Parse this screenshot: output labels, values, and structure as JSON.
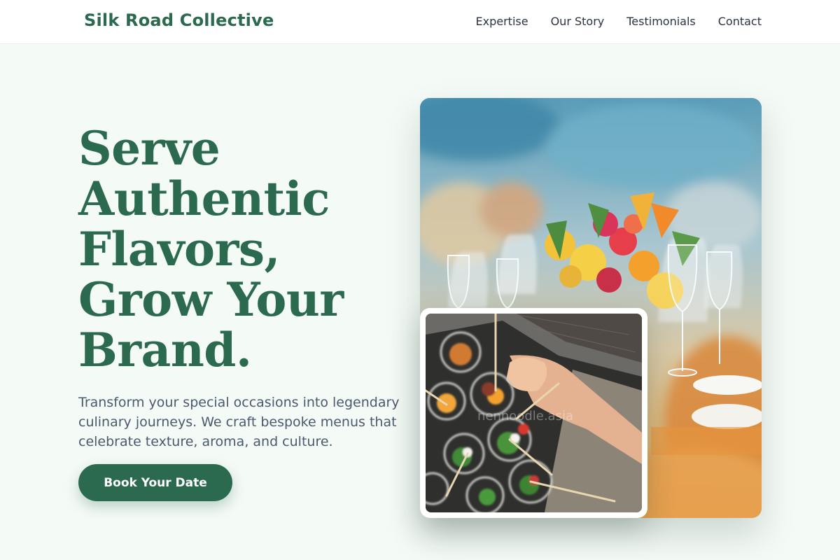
{
  "header": {
    "brand": "Silk Road Collective",
    "nav": [
      "Expertise",
      "Our Story",
      "Testimonials",
      "Contact"
    ]
  },
  "hero": {
    "title_lines": [
      "Serve",
      "Authentic",
      "Flavors,",
      "Grow Your",
      "Brand."
    ],
    "description": "Transform your special occasions into legendary culinary journeys. We craft bespoke menus that celebrate texture, aroma, and culture.",
    "cta_label": "Book Your Date"
  },
  "images": {
    "main": "banquet-table-flowers-glasses-photo",
    "inset": "canapes-cups-hand-photo",
    "watermark": "nennoodle.asia"
  },
  "colors": {
    "brand": "#2c6a4f",
    "background": "#f4faf6",
    "text": "#4a5a6e",
    "nav_text": "#2b3440"
  }
}
